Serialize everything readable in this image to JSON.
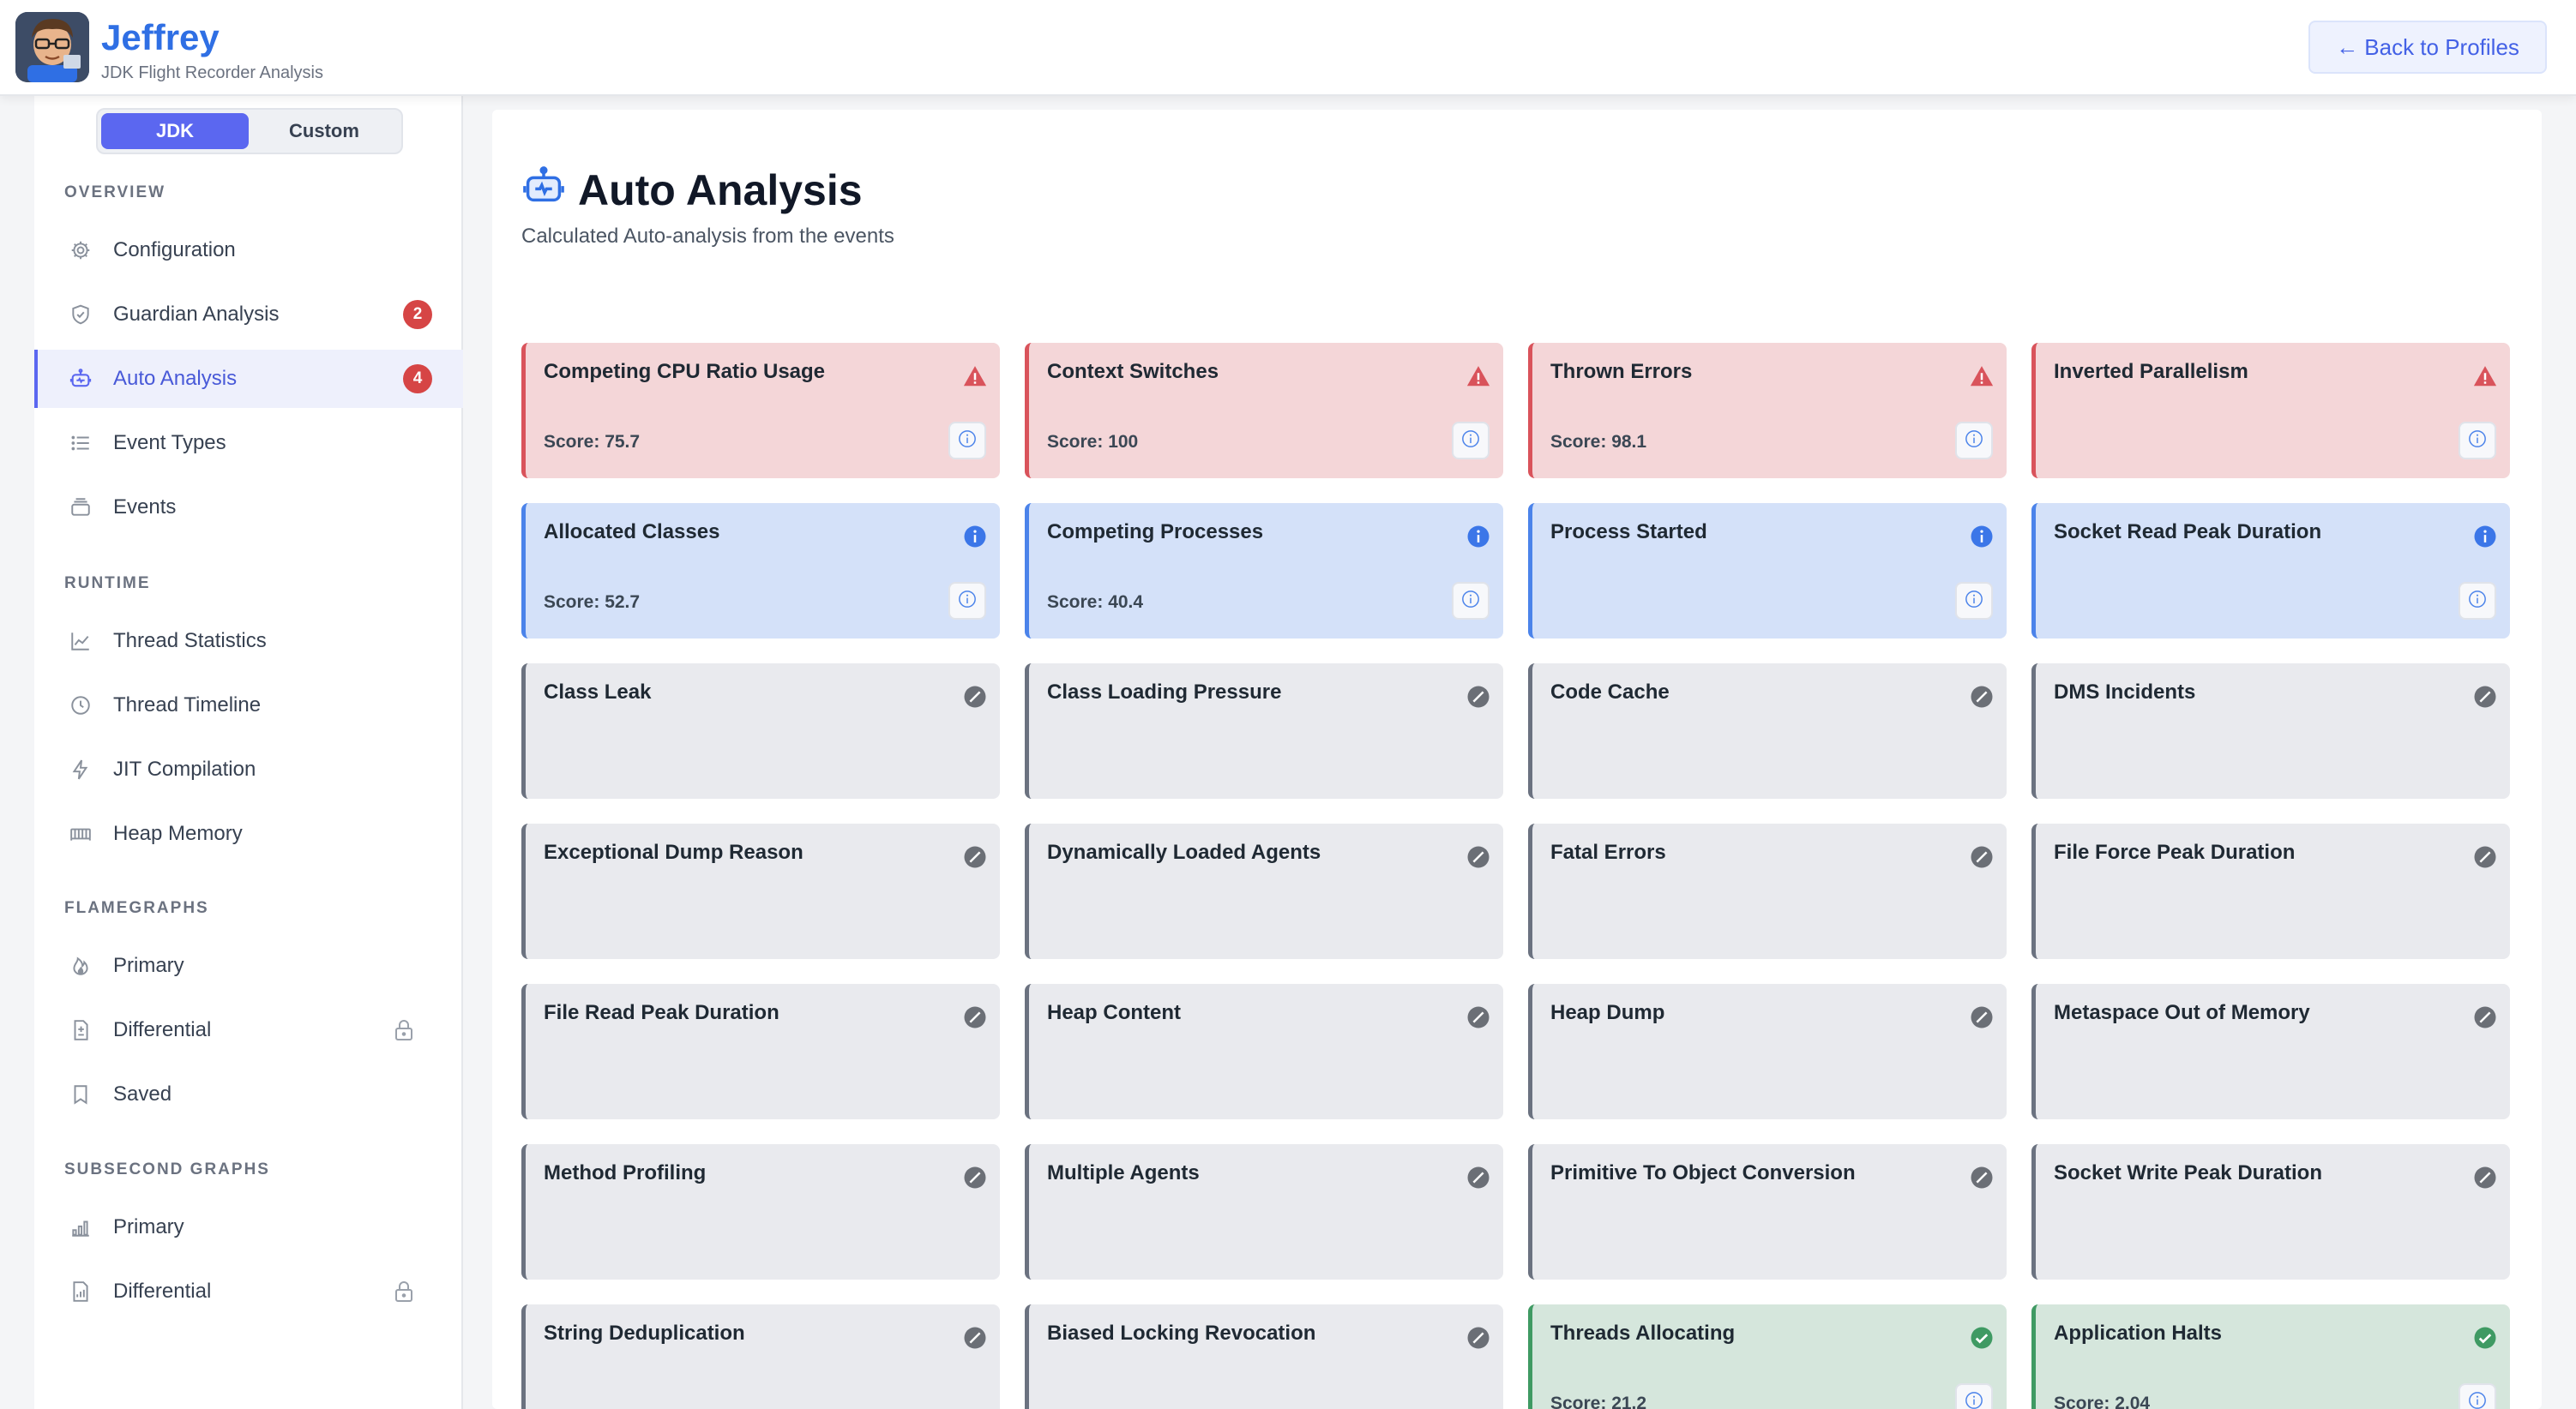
{
  "header": {
    "title": "Jeffrey",
    "subtitle": "JDK Flight Recorder Analysis",
    "back_label": "← Back to Profiles"
  },
  "sidebar": {
    "mode_tabs": [
      "JDK",
      "Custom"
    ],
    "active_mode": "JDK",
    "sections": [
      {
        "label": "OVERVIEW",
        "items": [
          {
            "label": "Configuration",
            "icon": "gear-icon"
          },
          {
            "label": "Guardian Analysis",
            "icon": "shield-icon",
            "badge": "2"
          },
          {
            "label": "Auto Analysis",
            "icon": "robot-icon",
            "badge": "4",
            "active": true
          },
          {
            "label": "Event Types",
            "icon": "list-icon"
          },
          {
            "label": "Events",
            "icon": "stack-icon"
          }
        ]
      },
      {
        "label": "RUNTIME",
        "items": [
          {
            "label": "Thread Statistics",
            "icon": "line-chart-icon"
          },
          {
            "label": "Thread Timeline",
            "icon": "clock-icon"
          },
          {
            "label": "JIT Compilation",
            "icon": "bolt-icon"
          },
          {
            "label": "Heap Memory",
            "icon": "memory-icon"
          }
        ]
      },
      {
        "label": "FLAMEGRAPHS",
        "items": [
          {
            "label": "Primary",
            "icon": "flame-icon"
          },
          {
            "label": "Differential",
            "icon": "file-diff-icon",
            "locked": true
          },
          {
            "label": "Saved",
            "icon": "bookmark-icon"
          }
        ]
      },
      {
        "label": "SUBSECOND GRAPHS",
        "items": [
          {
            "label": "Primary",
            "icon": "bar-chart-icon"
          },
          {
            "label": "Differential",
            "icon": "bar-chart-file-icon",
            "locked": true
          }
        ]
      }
    ]
  },
  "main": {
    "title": "Auto Analysis",
    "subtitle": "Calculated Auto-analysis from the events",
    "colors": {
      "warning": "#d9535b",
      "info": "#4b83ea",
      "ok": "#6b7280",
      "success": "#3f9a63"
    },
    "cards": [
      {
        "title": "Competing CPU Ratio Usage",
        "status": "warning",
        "score": "Score: 75.7"
      },
      {
        "title": "Context Switches",
        "status": "warning",
        "score": "Score: 100"
      },
      {
        "title": "Thrown Errors",
        "status": "warning",
        "score": "Score: 98.1"
      },
      {
        "title": "Inverted Parallelism",
        "status": "warning",
        "score": ""
      },
      {
        "title": "Allocated Classes",
        "status": "info",
        "score": "Score: 52.7"
      },
      {
        "title": "Competing Processes",
        "status": "info",
        "score": "Score: 40.4"
      },
      {
        "title": "Process Started",
        "status": "info",
        "score": ""
      },
      {
        "title": "Socket Read Peak Duration",
        "status": "info",
        "score": ""
      },
      {
        "title": "Class Leak",
        "status": "ok"
      },
      {
        "title": "Class Loading Pressure",
        "status": "ok"
      },
      {
        "title": "Code Cache",
        "status": "ok"
      },
      {
        "title": "DMS Incidents",
        "status": "ok"
      },
      {
        "title": "Exceptional Dump Reason",
        "status": "ok"
      },
      {
        "title": "Dynamically Loaded Agents",
        "status": "ok"
      },
      {
        "title": "Fatal Errors",
        "status": "ok"
      },
      {
        "title": "File Force Peak Duration",
        "status": "ok"
      },
      {
        "title": "File Read Peak Duration",
        "status": "ok"
      },
      {
        "title": "Heap Content",
        "status": "ok"
      },
      {
        "title": "Heap Dump",
        "status": "ok"
      },
      {
        "title": "Metaspace Out of Memory",
        "status": "ok"
      },
      {
        "title": "Method Profiling",
        "status": "ok"
      },
      {
        "title": "Multiple Agents",
        "status": "ok"
      },
      {
        "title": "Primitive To Object Conversion",
        "status": "ok"
      },
      {
        "title": "Socket Write Peak Duration",
        "status": "ok"
      },
      {
        "title": "String Deduplication",
        "status": "ok"
      },
      {
        "title": "Biased Locking Revocation",
        "status": "ok"
      },
      {
        "title": "Threads Allocating",
        "status": "success",
        "score": "Score: 21.2"
      },
      {
        "title": "Application Halts",
        "status": "success",
        "score": "Score: 2.04"
      }
    ]
  }
}
